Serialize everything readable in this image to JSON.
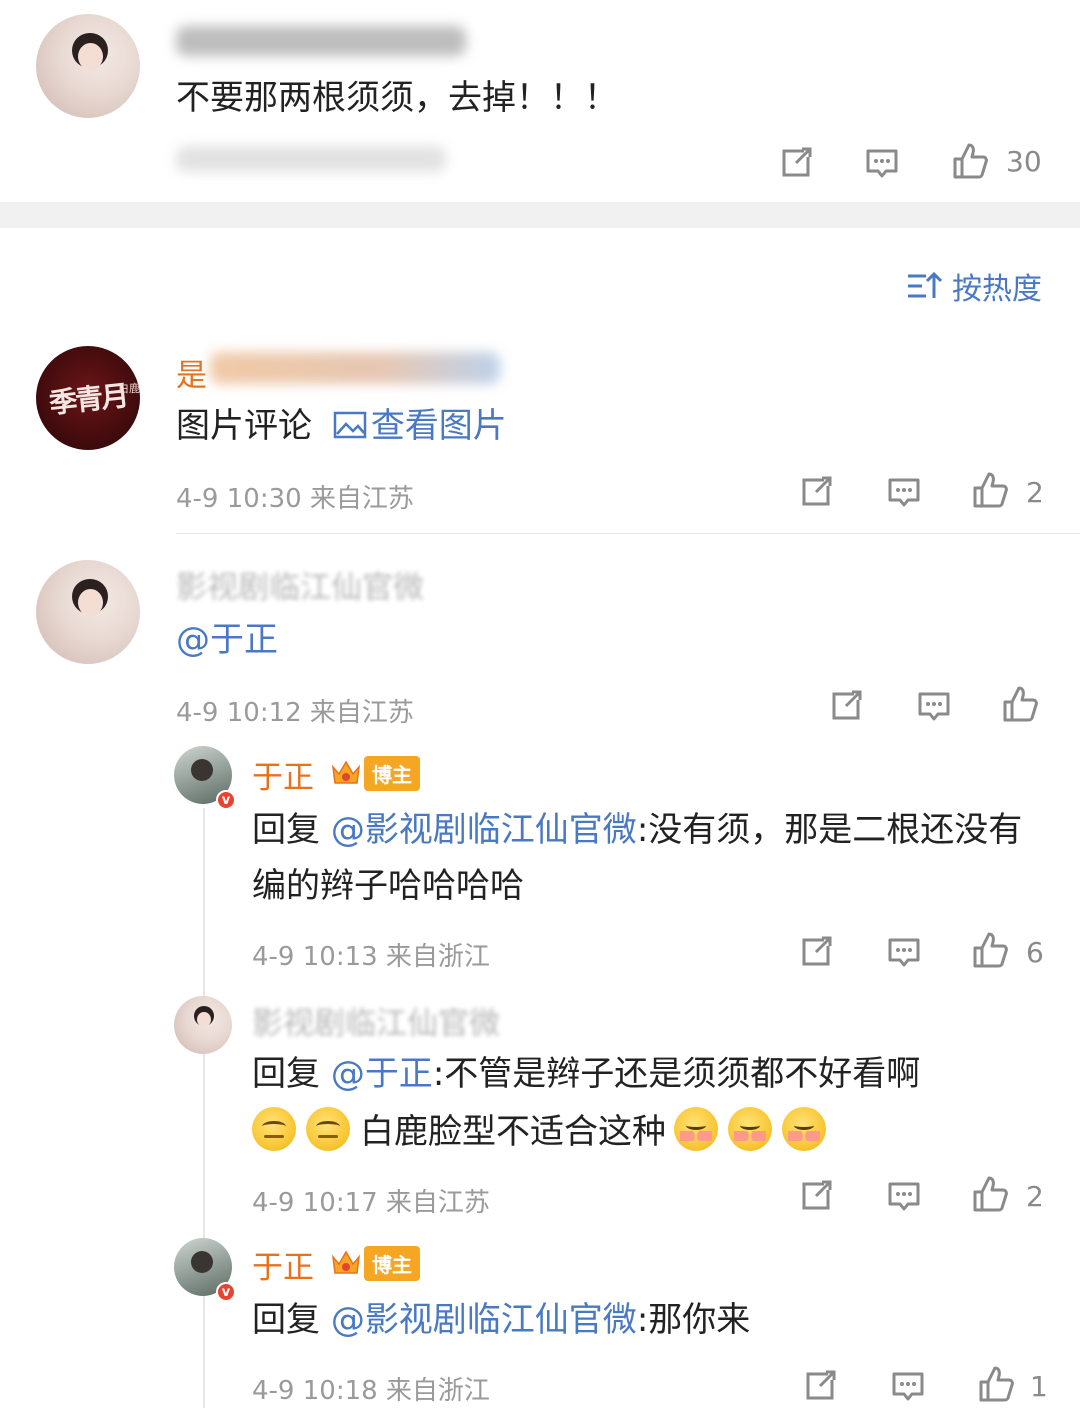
{
  "top_comment": {
    "text": "不要那两根须须，去掉！！！",
    "likes": "30"
  },
  "sort": {
    "label": "按热度"
  },
  "comments": [
    {
      "name_visible": "是",
      "text_plain": "图片评论",
      "text_link": "查看图片",
      "meta": "4-9 10:30  来自江苏",
      "likes": "2"
    },
    {
      "name_visible": "影视剧临江仙官微",
      "text_link": "@于正",
      "meta": "4-9 10:12  来自江苏",
      "likes": ""
    }
  ],
  "replies": [
    {
      "name": "于正",
      "badge": "博主",
      "prefix": "回复 ",
      "mention": "@影视剧临江仙官微",
      "text": ":没有须，那是二根还没有编的辫子哈哈哈哈",
      "meta": "4-9 10:13  来自浙江",
      "likes": "6"
    },
    {
      "name": "影视剧临江仙官微",
      "prefix": "回复 ",
      "mention": "@于正",
      "text": ":不管是辫子还是须须都不好看啊",
      "text2": "白鹿脸型不适合这种",
      "meta": "4-9 10:17  来自江苏",
      "likes": "2"
    },
    {
      "name": "于正",
      "badge": "博主",
      "prefix": "回复 ",
      "mention": "@影视剧临江仙官微",
      "text": ":那你来",
      "meta": "4-9 10:18  来自浙江",
      "likes": "1"
    }
  ],
  "avatars": {
    "dark_text": "季青月",
    "dark_small": "白鹿"
  },
  "colors": {
    "link": "#4a79c4",
    "name_orange": "#e8711c",
    "meta": "#9a9a9a",
    "badge": "#f5a623"
  }
}
